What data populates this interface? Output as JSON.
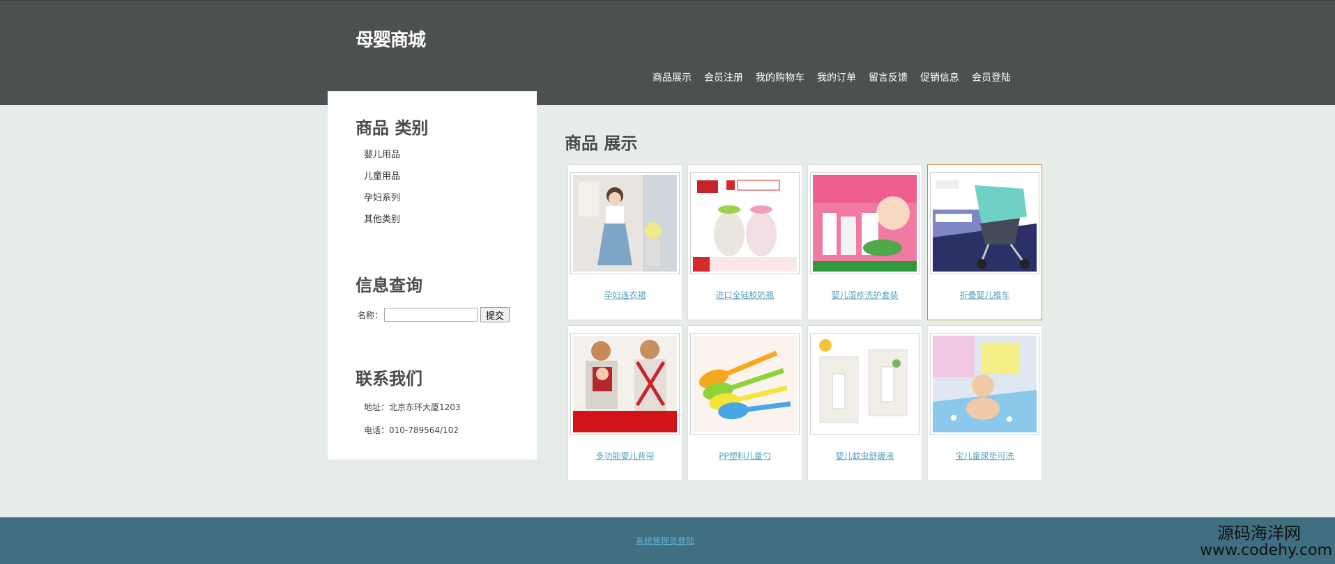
{
  "header": {
    "logo": "母婴商城",
    "nav": [
      "商品展示",
      "会员注册",
      "我的购物车",
      "我的订单",
      "留言反馈",
      "促销信息",
      "会员登陆"
    ]
  },
  "sidebar": {
    "category_title": "商品 类别",
    "categories": [
      "婴儿用品",
      "儿童用品",
      "孕妇系列",
      "其他类别"
    ],
    "search_title": "信息查询",
    "search_label": "名称：",
    "search_value": "",
    "search_button": "提交",
    "contact_title": "联系我们",
    "address": "地址：北京东环大厦1203",
    "phone": "电话：010-789564/102"
  },
  "main": {
    "title": "商品 展示",
    "products": [
      {
        "name": "孕妇连衣裙",
        "icon": "maternity-dress-image"
      },
      {
        "name": "进口全硅胶奶瓶",
        "icon": "baby-bottle-image"
      },
      {
        "name": "婴儿湿疹洗护套装",
        "icon": "skincare-set-image"
      },
      {
        "name": "折叠婴儿推车",
        "icon": "stroller-image"
      },
      {
        "name": "多功能婴儿背带",
        "icon": "baby-carrier-image"
      },
      {
        "name": "PP塑料儿童勺",
        "icon": "spoon-image"
      },
      {
        "name": "婴儿蚊虫舒缓液",
        "icon": "relief-liquid-image"
      },
      {
        "name": "宝儿童尿垫可洗",
        "icon": "diaper-pad-image"
      }
    ]
  },
  "footer": {
    "admin_link": "系统管理员登陆"
  },
  "watermark": {
    "line1": "源码海洋网",
    "line2": "www.codehy.com"
  },
  "colors": {
    "header_bg": "#4c5051",
    "page_bg": "#e6ece8",
    "footer_bg": "#3f6f80",
    "link": "#5aa0bf"
  }
}
